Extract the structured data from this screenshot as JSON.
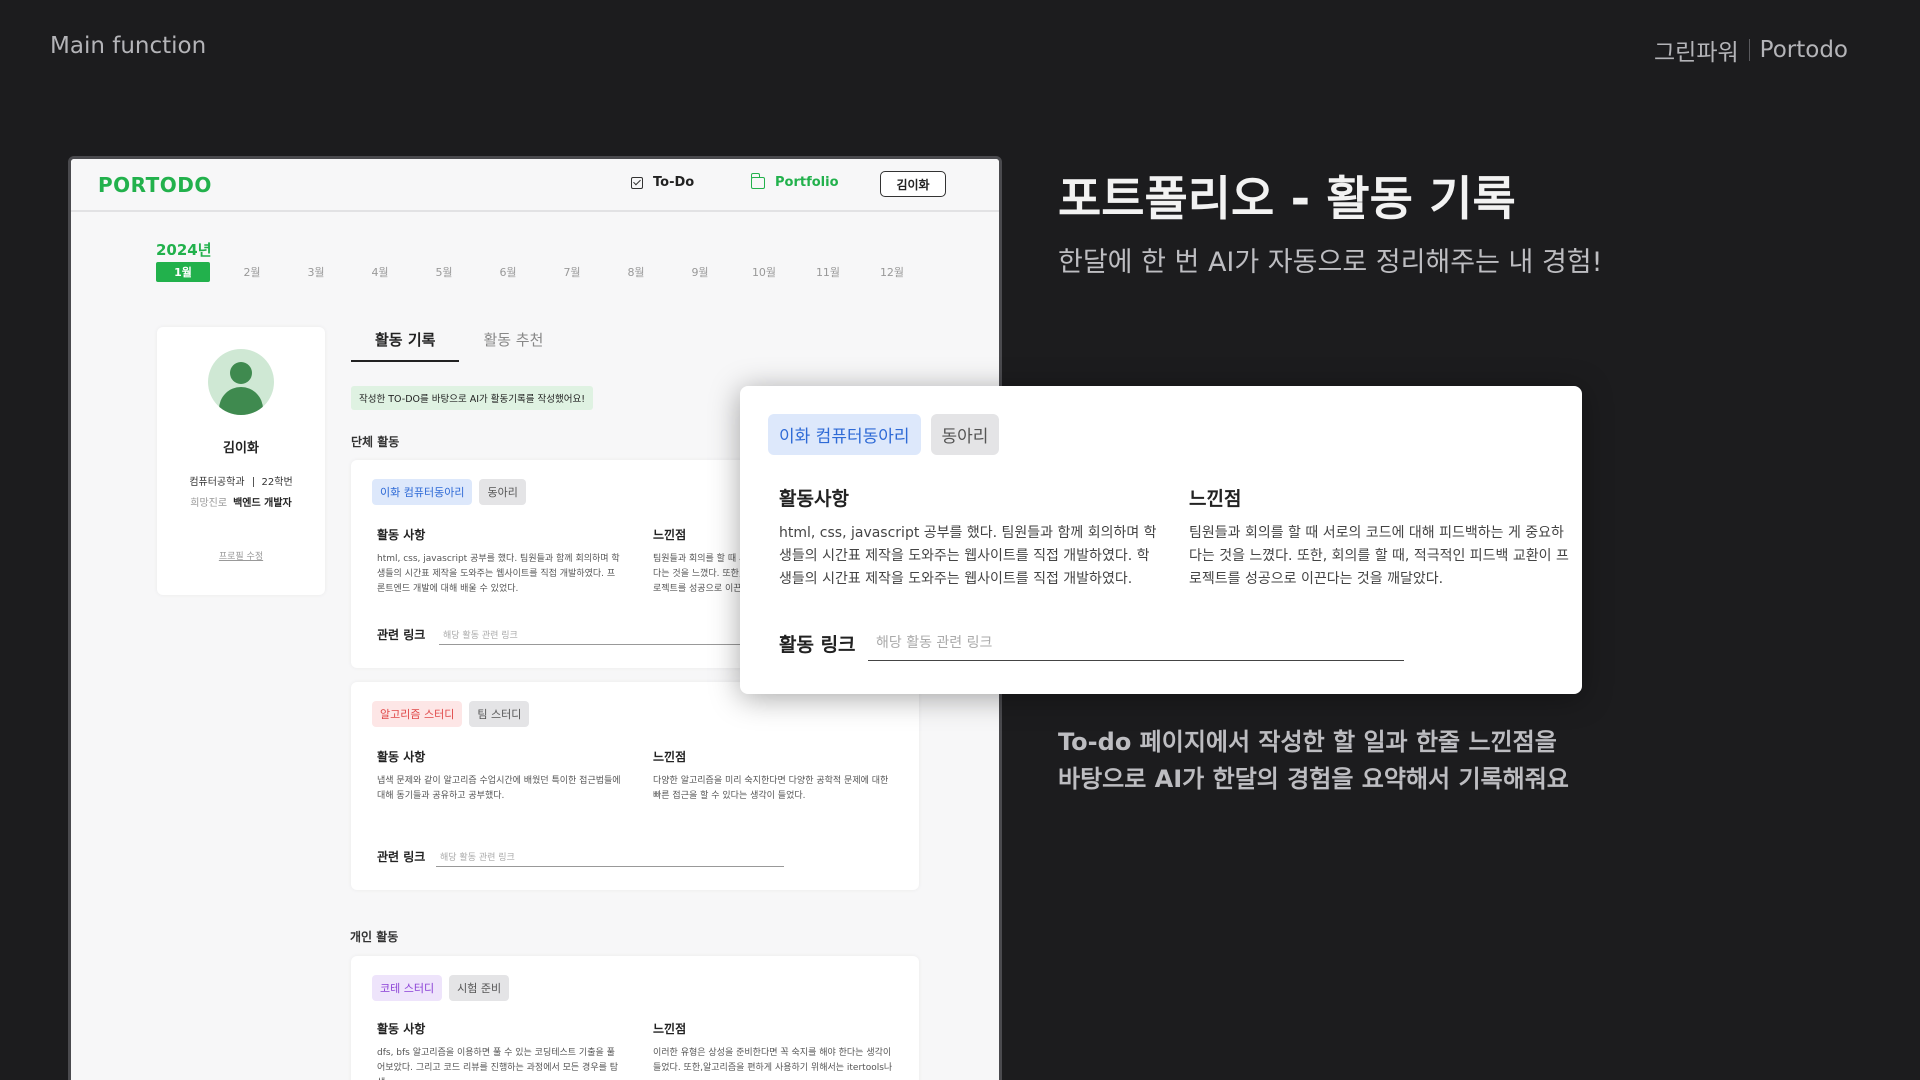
{
  "header": {
    "left": "Main function",
    "brand": "그린파워",
    "product": "Portodo"
  },
  "app": {
    "logo": "PORTODO",
    "nav": {
      "todo": "To-Do",
      "portfolio": "Portfolio",
      "user": "김이화"
    },
    "year": "2024년",
    "months": [
      "1월",
      "2월",
      "3월",
      "4월",
      "5월",
      "6월",
      "7월",
      "8월",
      "9월",
      "10월",
      "11월",
      "12월"
    ],
    "profile": {
      "name": "김이화",
      "dept": "컴퓨터공학과",
      "grade": "22학번",
      "goal_label": "희망진로",
      "goal": "백엔드 개발자",
      "edit": "프로필 수정"
    },
    "tabs": [
      "활동 기록",
      "활동 추천"
    ],
    "notice": "작성한 TO-DO를 바탕으로 AI가 활동기록를 작성했어요!",
    "group_title": "단체 활동",
    "personal_title": "개인 활동",
    "cards": [
      {
        "tag1": "이화 컴퓨터동아리",
        "tag2": "동아리",
        "act_h": "활동 사항",
        "act": "html, css, javascript 공부를 했다. 팀원들과 함께 회의하며 학생들의 시간표 제작을 도와주는 웹사이트를 직접 개발하였다. 프론트엔드 개발에 대해 배울 수 있었다.",
        "feel_h": "느낀점",
        "feel": "팀원들과 회의를 할 때 서로의 코드에 대해 피드백하는 게 중요하다는 것을 느꼈다. 또한, 회의를 할 때, 적극적인 피드백 교환이 프로젝트를 성공으로 이끈다는 것을 깨달았다.",
        "link_h": "관련 링크",
        "link_ph": "해당 활동 관련 링크"
      },
      {
        "tag1": "알고리즘 스터디",
        "tag2": "팀 스터디",
        "act_h": "활동 사항",
        "act": "냅색 문제와 같이 알고리즘 수업시간에 배웠던 특이한 접근법들에 대해 동기들과 공유하고 공부했다.",
        "feel_h": "느낀점",
        "feel": "다양한 알고리즘을 미리 숙지한다면 다양한 공학적 문제에 대한 빠른 접근을 할 수 있다는 생각이 들었다.",
        "link_h": "관련 링크",
        "link_ph": "해당 활동 관련 링크"
      },
      {
        "tag1": "코테 스터디",
        "tag2": "시험 준비",
        "act_h": "활동 사항",
        "act": "dfs, bfs 알고리즘을 이용하면 풀 수 있는 코딩테스트 기출을 풀어보았다. 그리고 코드 리뷰를 진행하는 과정에서 모든 경우를 탐색",
        "feel_h": "느낀점",
        "feel": "이러한 유형은 상성을 준비한다면 꼭 숙지를 해야 한다는 생각이 들었다. 또한,알고리즘을 편하게 사용하기 위해서는 itertools나"
      }
    ]
  },
  "popup": {
    "tag1": "이화 컴퓨터동아리",
    "tag2": "동아리",
    "act_h": "활동사항",
    "act": "html, css, javascript 공부를 했다. 팀원들과 함께 회의하며 학생들의 시간표 제작을 도와주는 웹사이트를 직접 개발하였다. 학생들의 시간표 제작을 도와주는 웹사이트를 직접 개발하였다.",
    "feel_h": "느낀점",
    "feel": "팀원들과 회의를 할 때 서로의 코드에 대해 피드백하는 게 중요하다는 것을 느꼈다. 또한, 회의를 할 때, 적극적인 피드백 교환이 프로젝트를 성공으로 이끈다는 것을 깨달았다.",
    "link_h": "활동 링크",
    "link_ph": "해당 활동 관련 링크"
  },
  "hero": {
    "title": "포트폴리오 - 활동 기록",
    "subtitle": "한달에 한 번 AI가 자동으로 정리해주는 내 경험!",
    "desc1": "To-do 페이지에서 작성한 할 일과 한줄 느낀점을",
    "desc2": "바탕으로 AI가 한달의 경험을 요약해서 기록해줘요"
  },
  "colors": {
    "accent": "#22b14c",
    "background": "#1c1c1e"
  }
}
